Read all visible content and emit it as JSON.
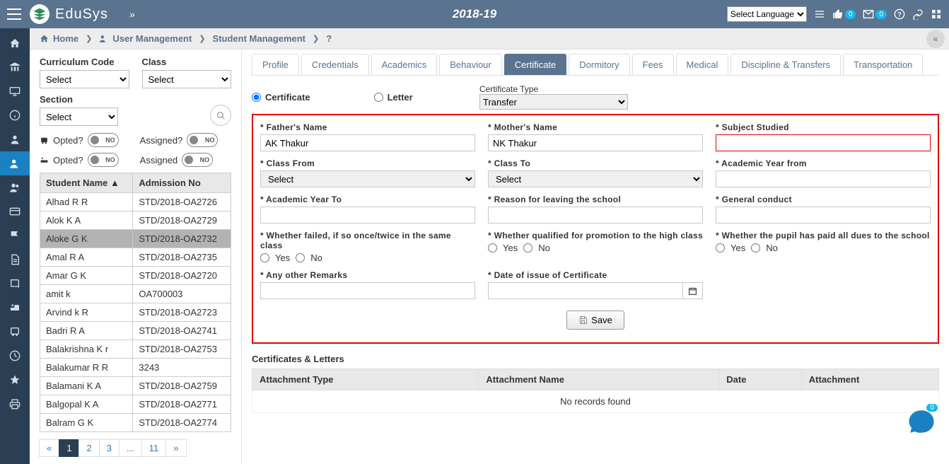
{
  "brand": "EduSys",
  "year": "2018-19",
  "lang_placeholder": "Select Language",
  "badges": {
    "thumb": "0",
    "mail": "0",
    "chat": "0"
  },
  "breadcrumb": {
    "home": "Home",
    "um": "User Management",
    "sm": "Student Management",
    "q": "?"
  },
  "filters": {
    "curriculum_label": "Curriculum Code",
    "curriculum_value": "Select",
    "class_label": "Class",
    "class_value": "Select",
    "section_label": "Section",
    "section_value": "Select",
    "opted_bus": "Opted?",
    "assigned_bus": "Assigned?",
    "opted_bed": "Opted?",
    "assigned_bed": "Assigned",
    "no": "NO"
  },
  "student_table": {
    "head": {
      "name": "Student Name",
      "adm": "Admission No"
    },
    "rows": [
      {
        "name": "Alhad R R",
        "adm": "STD/2018-OA2726"
      },
      {
        "name": "Alok K A",
        "adm": "STD/2018-OA2729"
      },
      {
        "name": "Aloke G K",
        "adm": "STD/2018-OA2732",
        "selected": true
      },
      {
        "name": "Amal R A",
        "adm": "STD/2018-OA2735"
      },
      {
        "name": "Amar G K",
        "adm": "STD/2018-OA2720"
      },
      {
        "name": "amit k",
        "adm": "OA700003"
      },
      {
        "name": "Arvind k R",
        "adm": "STD/2018-OA2723"
      },
      {
        "name": "Badri R A",
        "adm": "STD/2018-OA2741"
      },
      {
        "name": "Balakrishna K r",
        "adm": "STD/2018-OA2753"
      },
      {
        "name": "Balakumar R R",
        "adm": "3243"
      },
      {
        "name": "Balamani K A",
        "adm": "STD/2018-OA2759"
      },
      {
        "name": "Balgopal K A",
        "adm": "STD/2018-OA2771"
      },
      {
        "name": "Balram G K",
        "adm": "STD/2018-OA2774"
      }
    ]
  },
  "pager": [
    "«",
    "1",
    "2",
    "3",
    "...",
    "11",
    "»"
  ],
  "tabs": [
    "Profile",
    "Credentials",
    "Academics",
    "Behaviour",
    "Certificate",
    "Dormitory",
    "Fees",
    "Medical",
    "Discipline & Transfers",
    "Transportation"
  ],
  "active_tab": "Certificate",
  "mode": {
    "certificate": "Certificate",
    "letter": "Letter"
  },
  "ctype": {
    "label": "Certificate Type",
    "value": "Transfer"
  },
  "form": {
    "father": {
      "label": "* Father's Name",
      "value": "AK Thakur"
    },
    "mother": {
      "label": "* Mother's Name",
      "value": "NK Thakur"
    },
    "subject": {
      "label": "* Subject Studied",
      "value": ""
    },
    "class_from": {
      "label": "* Class From",
      "value": "Select"
    },
    "class_to": {
      "label": "* Class To",
      "value": "Select"
    },
    "ay_from": {
      "label": "* Academic Year from",
      "value": ""
    },
    "ay_to": {
      "label": "* Academic Year To",
      "value": ""
    },
    "reason": {
      "label": "* Reason for leaving the school",
      "value": ""
    },
    "conduct": {
      "label": "* General conduct",
      "value": ""
    },
    "failed": {
      "label": "* Whether failed, if so once/twice in the same class"
    },
    "qualified": {
      "label": "* Whether qualified for promotion to the high class"
    },
    "dues": {
      "label": "* Whether the pupil has paid all dues to the school"
    },
    "remarks": {
      "label": "* Any other Remarks",
      "value": ""
    },
    "issue_date": {
      "label": "* Date of issue of Certificate",
      "value": ""
    },
    "yes": "Yes",
    "no": "No",
    "save": "Save"
  },
  "cert_letters": {
    "title": "Certificates & Letters",
    "head": {
      "type": "Attachment Type",
      "name": "Attachment Name",
      "date": "Date",
      "att": "Attachment"
    },
    "empty": "No records found"
  }
}
